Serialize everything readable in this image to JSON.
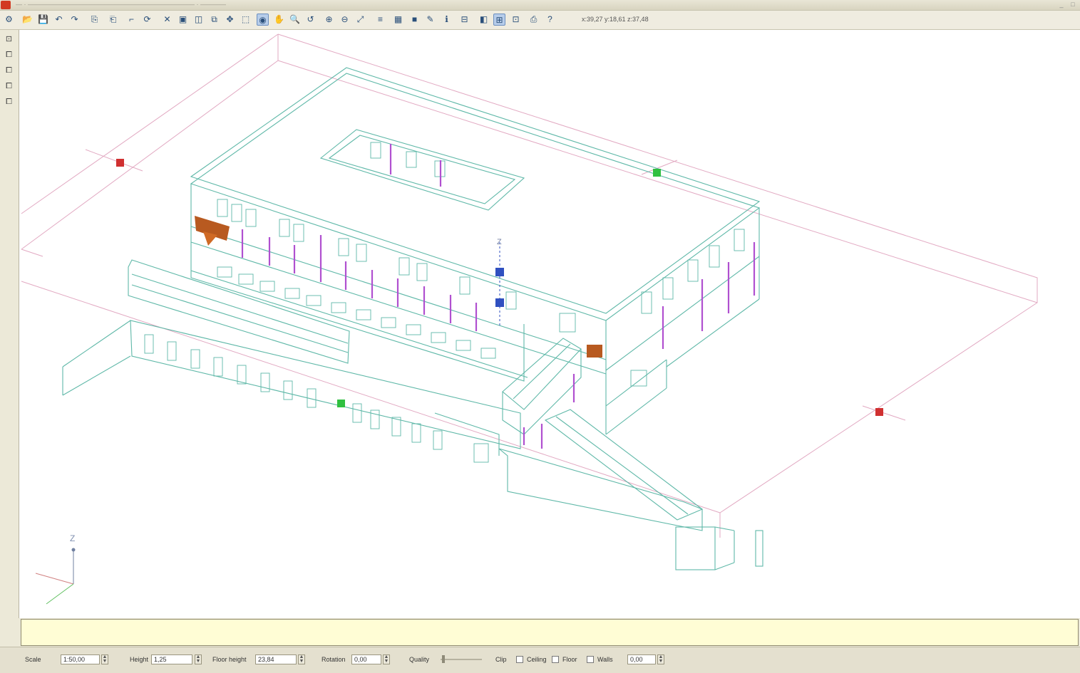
{
  "window": {
    "title": "— · —————————————————————————— · ————",
    "controls": [
      "_",
      "□"
    ]
  },
  "toolbar": {
    "icons": [
      "settings-icon",
      "open-icon",
      "save-icon",
      "undo-icon",
      "redo-icon",
      "copy-icon",
      "paste-icon",
      "line-tool-icon",
      "orbit-icon",
      "delete-icon",
      "box-icon",
      "layers-icon",
      "copy-object-icon",
      "move-icon",
      "select-icon",
      "view-3d-icon",
      "pan-icon",
      "zoom-icon",
      "rotate-icon",
      "zoom-in-icon",
      "zoom-out-icon",
      "zoom-fit-icon",
      "list-icon",
      "render-icon",
      "fill-icon",
      "edit-icon",
      "info-icon",
      "stack-icon",
      "section-icon",
      "plan-view-icon",
      "grid-icon",
      "print-icon",
      "help-icon"
    ],
    "glyphs": [
      "⚙",
      "📂",
      "💾",
      "↶",
      "↷",
      "⎘",
      "⎗",
      "⌐",
      "⟳",
      "✕",
      "▣",
      "◫",
      "⧉",
      "✥",
      "⬚",
      "◉",
      "✋",
      "🔍",
      "↺",
      "⊕",
      "⊖",
      "⤢",
      "≡",
      "▦",
      "■",
      "✎",
      "ℹ",
      "⊟",
      "◧",
      "⊞",
      "⊡",
      "⎙",
      "?"
    ],
    "coords": "x:39,27 y:18,61 z:37,48"
  },
  "side_toolbar": {
    "glyphs": [
      "⊡",
      "⧠",
      "⧠",
      "⧠",
      "⧠"
    ]
  },
  "command_line": {
    "text": ""
  },
  "status": {
    "scale_label": "Scale",
    "scale_value": "1:50,00",
    "height_label": "Height",
    "height_value": "1,25",
    "floor_height_label": "Floor height",
    "floor_height_value": "23,84",
    "rotation_label": "Rotation",
    "rotation_value": "0,00",
    "quality_label": "Quality",
    "clip_label": "Clip",
    "ceiling_label": "Ceiling",
    "floor_label": "Floor",
    "walls_label": "Walls",
    "walls_value": "0,00"
  },
  "viewport": {
    "wire_color": "#5fb8a8",
    "edge_color": "#e0a8c0",
    "column_color": "#b050d0",
    "accent_orange": "#b85a20",
    "marker_red": "#d03030",
    "marker_green": "#30c040",
    "marker_blue": "#3050c0",
    "axis_z": "Z"
  }
}
